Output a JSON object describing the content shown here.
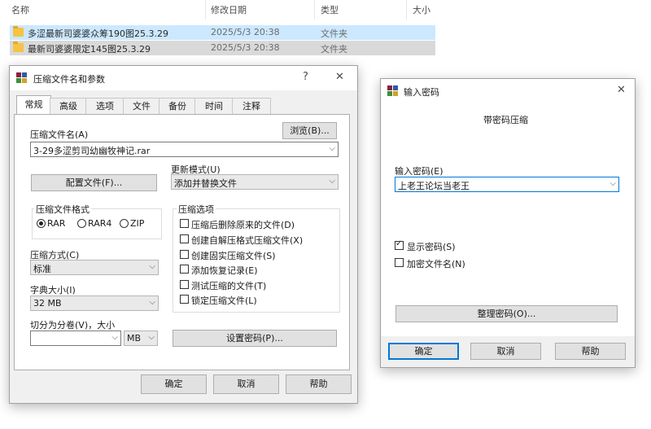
{
  "explorer": {
    "columns": [
      "名称",
      "修改日期",
      "类型",
      "大小"
    ],
    "rows": [
      {
        "name": "多涩最新司婆婆众筹190图25.3.29",
        "date": "2025/5/3 20:38",
        "type": "文件夹"
      },
      {
        "name": "最新司婆婆限定145图25.3.29",
        "date": "2025/5/3 20:38",
        "type": "文件夹"
      }
    ]
  },
  "archive_dialog": {
    "title": "压缩文件名和参数",
    "help_glyph": "?",
    "close_glyph": "✕",
    "tabs": [
      "常规",
      "高级",
      "选项",
      "文件",
      "备份",
      "时间",
      "注释"
    ],
    "archive_name_label": "压缩文件名(A)",
    "browse_button": "浏览(B)...",
    "archive_name_value": "3-29多涩剪司幼幽牧神记.rar",
    "profiles_button": "配置文件(F)...",
    "update_mode_label": "更新模式(U)",
    "update_mode_value": "添加并替换文件",
    "format_group": "压缩文件格式",
    "formats": [
      "RAR",
      "RAR4",
      "ZIP"
    ],
    "options_group": "压缩选项",
    "options": [
      {
        "label": "压缩后删除原来的文件(D)",
        "checked": false
      },
      {
        "label": "创建自解压格式压缩文件(X)",
        "checked": false
      },
      {
        "label": "创建固实压缩文件(S)",
        "checked": false
      },
      {
        "label": "添加恢复记录(E)",
        "checked": false
      },
      {
        "label": "测试压缩的文件(T)",
        "checked": false
      },
      {
        "label": "锁定压缩文件(L)",
        "checked": false
      }
    ],
    "method_label": "压缩方式(C)",
    "method_value": "标准",
    "dict_label": "字典大小(I)",
    "dict_value": "32 MB",
    "split_label": "切分为分卷(V)，大小",
    "split_value": "",
    "split_unit": "MB",
    "set_password_button": "设置密码(P)...",
    "ok": "确定",
    "cancel": "取消",
    "help": "帮助"
  },
  "password_dialog": {
    "title": "输入密码",
    "close_glyph": "✕",
    "heading": "带密码压缩",
    "password_label": "输入密码(E)",
    "password_value": "上老王论坛当老王",
    "show_password": "显示密码(S)",
    "show_password_checked": true,
    "encrypt_names": "加密文件名(N)",
    "encrypt_names_checked": false,
    "organize_button": "整理密码(O)...",
    "ok": "确定",
    "cancel": "取消",
    "help": "帮助"
  },
  "icons": [
    "folder-icon",
    "winrar-icon",
    "chevron-down-icon",
    "close-icon",
    "help-icon",
    "sort-up-icon"
  ]
}
